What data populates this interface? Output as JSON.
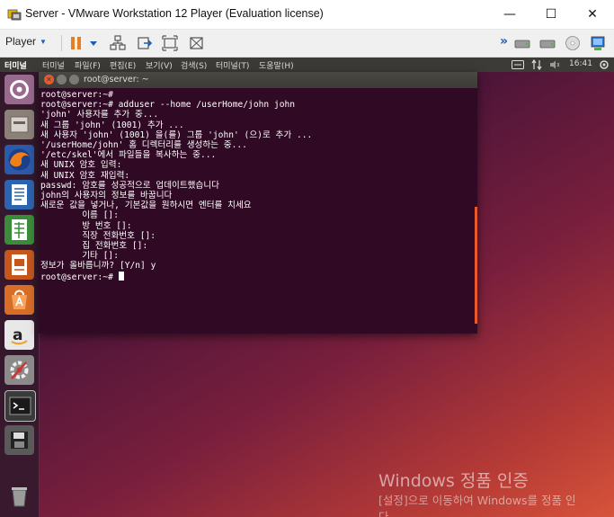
{
  "window": {
    "title": "Server - VMware Workstation 12 Player (Evaluation license)",
    "minimize": "—",
    "maximize": "☐",
    "close": "✕"
  },
  "toolbar": {
    "player_label": "Player",
    "player_caret": "▼",
    "chevron": "»"
  },
  "ubuntu_panel": {
    "app_name": "터미널",
    "menus": [
      "터미널",
      "파일(F)",
      "편집(E)",
      "보기(V)",
      "검색(S)",
      "터미널(T)",
      "도움말(H)"
    ],
    "time": "16:41"
  },
  "launcher": {
    "items": [
      "dash-icon",
      "files-icon",
      "firefox-icon",
      "writer-icon",
      "calc-icon",
      "impress-icon",
      "software-center-icon",
      "amazon-icon",
      "settings-icon",
      "terminal-icon",
      "save-icon",
      "trash-icon"
    ]
  },
  "terminal": {
    "title": "root@server: ~",
    "lines": [
      "root@server:~#",
      "root@server:~# adduser --home /userHome/john john",
      "'john' 사용자를 추가 중...",
      "새 그룹 'john' (1001) 추가 ...",
      "새 사용자 'john' (1001) 을(를) 그룹 'john' (으)로 추가 ...",
      "'/userHome/john' 홈 디렉터리를 생성하는 중...",
      "'/etc/skel'에서 파일들을 복사하는 중...",
      "새 UNIX 암호 입력:",
      "새 UNIX 암호 재입력:",
      "passwd: 암호를 성공적으로 업데이트했습니다",
      "john의 사용자의 정보를 바꿉니다",
      "새로운 값을 넣거나, 기본값을 원하시면 엔터를 치세요",
      "\t이름 []:",
      "\t방 번호 []:",
      "\t직장 전화번호 []:",
      "\t집 전화번호 []:",
      "\t기타 []:",
      "정보가 올바릅니까? [Y/n] y"
    ],
    "prompt": "root@server:~# "
  },
  "watermark": {
    "title": "Windows 정품 인증",
    "subtitle": "[설정]으로 이동하여 Windows를 정품 인",
    "subtitle_cont": "다"
  },
  "colors": {
    "terminal_bg": "#300a24",
    "ubuntu_panel": "#3c3b37",
    "close_btn": "#e9592b",
    "pause_icon": "#e67e22",
    "vmware_blue": "#1a5fb4"
  }
}
